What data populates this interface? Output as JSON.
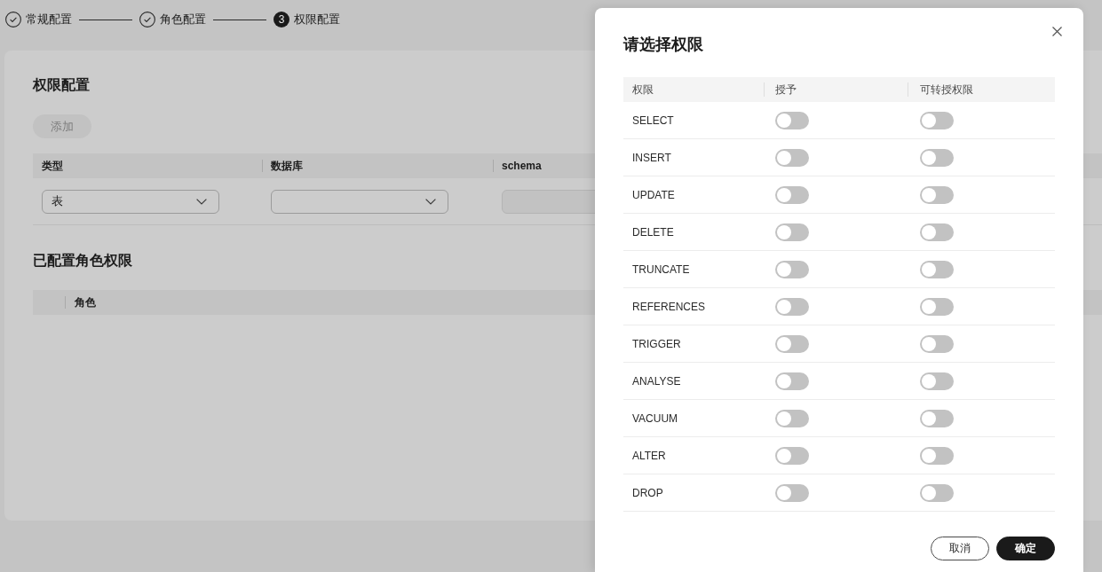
{
  "steps": [
    {
      "label": "常规配置",
      "done": true
    },
    {
      "label": "角色配置",
      "done": true
    },
    {
      "number": "3",
      "label": "权限配置",
      "done": false
    }
  ],
  "permission_config": {
    "title": "权限配置",
    "add_button": {
      "label": "添加",
      "disabled": true
    },
    "columns": [
      "类型",
      "数据库",
      "schema"
    ],
    "fields": [
      {
        "kind": "select",
        "value": "表"
      },
      {
        "kind": "select"
      },
      {
        "kind": "input",
        "disabled": true
      }
    ]
  },
  "configured_roles": {
    "title": "已配置角色权限",
    "columns": [
      "角色"
    ]
  },
  "dialog": {
    "title": "请选择权限",
    "columns": [
      "权限",
      "授予",
      "可转授权限"
    ],
    "rows": [
      {
        "name": "SELECT",
        "grant": false,
        "grant_option": false
      },
      {
        "name": "INSERT",
        "grant": false,
        "grant_option": false
      },
      {
        "name": "UPDATE",
        "grant": false,
        "grant_option": false
      },
      {
        "name": "DELETE",
        "grant": false,
        "grant_option": false
      },
      {
        "name": "TRUNCATE",
        "grant": false,
        "grant_option": false
      },
      {
        "name": "REFERENCES",
        "grant": false,
        "grant_option": false
      },
      {
        "name": "TRIGGER",
        "grant": false,
        "grant_option": false
      },
      {
        "name": "ANALYSE",
        "grant": false,
        "grant_option": false
      },
      {
        "name": "VACUUM",
        "grant": false,
        "grant_option": false
      },
      {
        "name": "ALTER",
        "grant": false,
        "grant_option": false
      },
      {
        "name": "DROP",
        "grant": false,
        "grant_option": false
      }
    ],
    "buttons": [
      {
        "label": "取消",
        "kind": "secondary"
      },
      {
        "label": "确定",
        "kind": "primary"
      }
    ]
  }
}
